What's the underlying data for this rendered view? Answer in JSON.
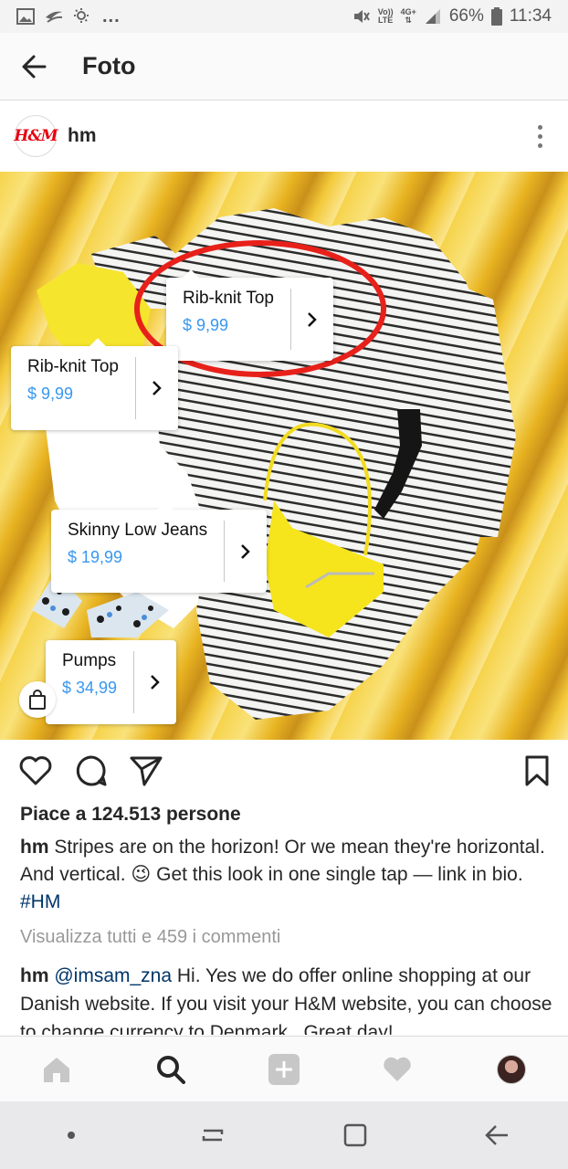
{
  "status_bar": {
    "battery": "66%",
    "time": "11:34",
    "volte": "Vo))",
    "lte": "LTE",
    "network": "4G+"
  },
  "app_bar": {
    "title": "Foto"
  },
  "post": {
    "username": "hm",
    "avatar_text": "H&M"
  },
  "tags": [
    {
      "name": "Rib-knit Top",
      "price": "$ 9,99"
    },
    {
      "name": "Rib-knit Top",
      "price": "$ 9,99"
    },
    {
      "name": "Skinny Low Jeans",
      "price": "$ 19,99"
    },
    {
      "name": "Pumps",
      "price": "$ 34,99"
    }
  ],
  "likes_text": "Piace a 124.513 persone",
  "caption": {
    "username": "hm",
    "text": "Stripes are on the horizon! Or we mean they're horizontal. And vertical. 😉 Get this look in one single tap — link in bio.",
    "hashtag": "#HM"
  },
  "view_all_comments": "Visualizza tutti e 459 i commenti",
  "comment": {
    "username": "hm",
    "mention": "@imsam_zna",
    "text": "Hi. Yes we do offer online shopping at our Danish website. If you visit your H&M website, you can choose to change currency to Denmark . Great day!"
  },
  "icons": {
    "back": "arrow-left-icon",
    "more": "more-vertical-icon",
    "like": "heart-icon",
    "comment": "comment-icon",
    "share": "paper-plane-icon",
    "save": "bookmark-icon",
    "shop": "shopping-bag-icon",
    "home": "home-icon",
    "search": "search-icon",
    "add": "add-icon",
    "activity": "heart-icon",
    "profile": "profile-avatar"
  },
  "colors": {
    "link": "#003569",
    "price": "#3897f0",
    "highlight_circle": "#e8201a"
  }
}
